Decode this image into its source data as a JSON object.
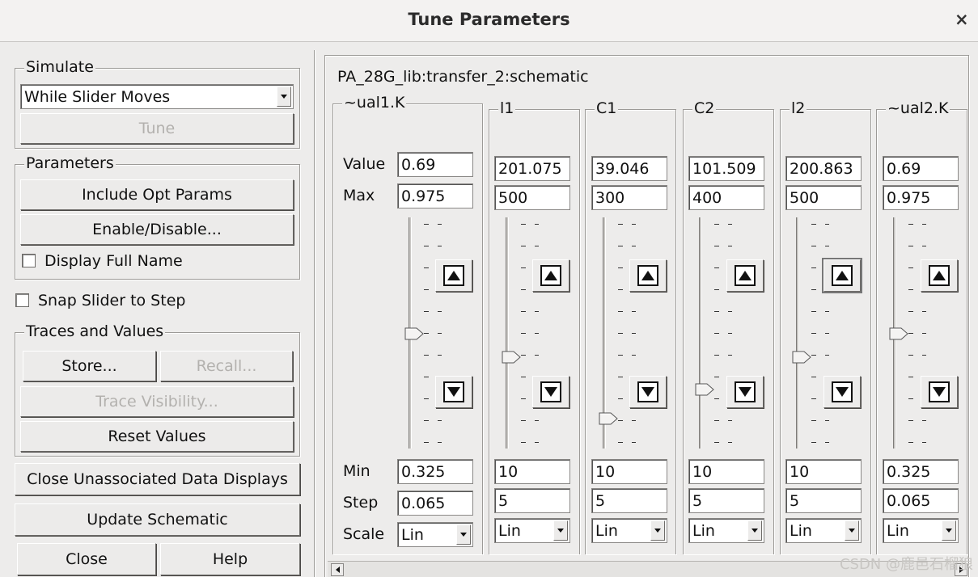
{
  "window": {
    "title": "Tune Parameters",
    "close_glyph": "×"
  },
  "left": {
    "simulate": {
      "label": "Simulate",
      "mode": "While Slider Moves",
      "tune_button": "Tune"
    },
    "parameters": {
      "label": "Parameters",
      "include_opt": "Include Opt Params",
      "enable_disable": "Enable/Disable...",
      "display_full_name": "Display Full Name"
    },
    "snap": "Snap Slider to Step",
    "traces": {
      "label": "Traces and Values",
      "store": "Store...",
      "recall": "Recall...",
      "trace_visibility": "Trace Visibility...",
      "reset": "Reset Values"
    },
    "close_unassociated": "Close Unassociated Data Displays",
    "update_schematic": "Update Schematic",
    "close": "Close",
    "help": "Help"
  },
  "right": {
    "schematic": "PA_28G_lib:transfer_2:schematic",
    "row_labels": {
      "value": "Value",
      "max": "Max",
      "min": "Min",
      "step": "Step",
      "scale": "Scale"
    },
    "params": [
      {
        "name": "~ual1.K",
        "value": "0.69",
        "max": "0.975",
        "min": "0.325",
        "step": "0.065",
        "scale": "Lin",
        "position": 0.5
      },
      {
        "name": "l1",
        "value": "201.075",
        "max": "500",
        "min": "10",
        "step": "5",
        "scale": "Lin",
        "position": 0.39
      },
      {
        "name": "C1",
        "value": "39.046",
        "max": "300",
        "min": "10",
        "step": "5",
        "scale": "Lin",
        "position": 0.1
      },
      {
        "name": "C2",
        "value": "101.509",
        "max": "400",
        "min": "10",
        "step": "5",
        "scale": "Lin",
        "position": 0.236
      },
      {
        "name": "l2",
        "value": "200.863",
        "max": "500",
        "min": "10",
        "step": "5",
        "scale": "Lin",
        "position": 0.39
      },
      {
        "name": "~ual2.K",
        "value": "0.69",
        "max": "0.975",
        "min": "0.325",
        "step": "0.065",
        "scale": "Lin",
        "position": 0.5
      }
    ]
  },
  "watermark": "CSDN @鹿邑石榴狼"
}
